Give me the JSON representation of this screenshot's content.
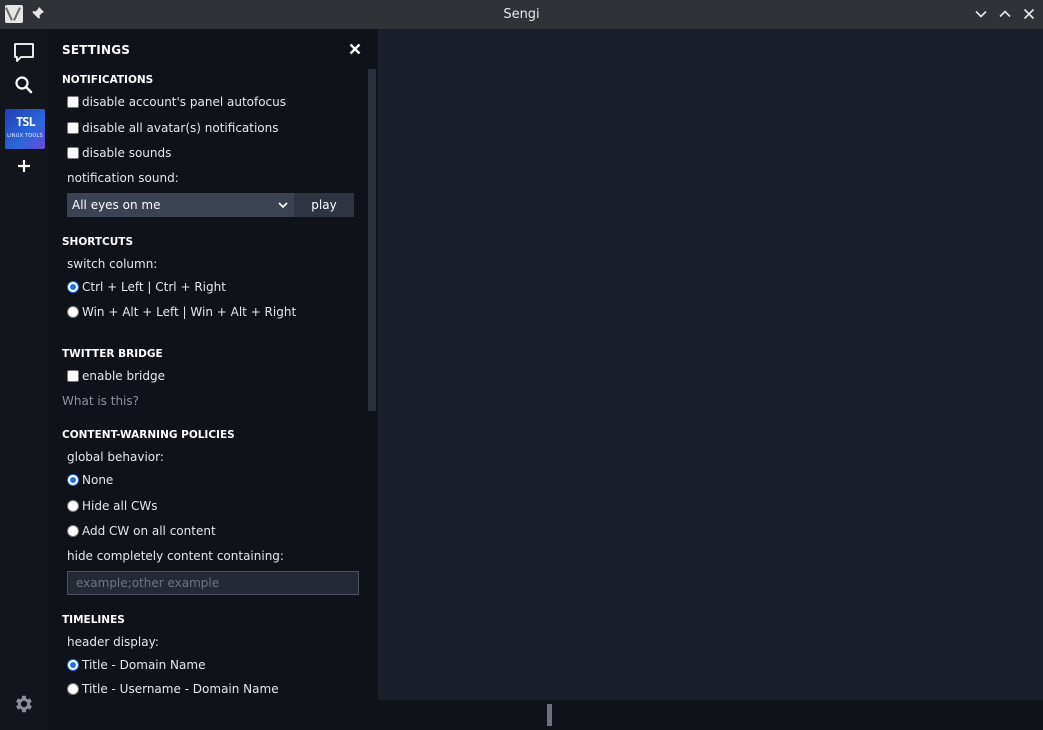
{
  "window": {
    "title": "Sengi"
  },
  "icons": {
    "app": "app-icon",
    "pin": "pin-icon",
    "minimize": "chevron-down-icon",
    "maximize": "chevron-up-icon",
    "close": "close-icon",
    "messages": "chat-bubble-icon",
    "search": "search-icon",
    "add": "plus-icon",
    "settings": "gear-icon",
    "select": "chevron-down-icon"
  },
  "account": {
    "avatar_line1": "TSL",
    "avatar_line2": "LINUX TOOLS"
  },
  "settings": {
    "title": "SETTINGS",
    "notifications": {
      "title": "NOTIFICATIONS",
      "disable_autofocus": "disable account's panel autofocus",
      "disable_avatar_notifications": "disable all avatar(s) notifications",
      "disable_sounds": "disable sounds",
      "sound_label": "notification sound:",
      "sound_value": "All eyes on me",
      "play_label": "play"
    },
    "shortcuts": {
      "title": "SHORTCUTS",
      "switch_label": "switch column:",
      "option1": "Ctrl + Left | Ctrl + Right",
      "option2": "Win + Alt + Left | Win + Alt + Right",
      "selected": "option1"
    },
    "twitter_bridge": {
      "title": "TWITTER BRIDGE",
      "enable_label": "enable bridge",
      "what_is_this": "What is this?"
    },
    "content_warning": {
      "title": "CONTENT-WARNING POLICIES",
      "global_label": "global behavior:",
      "none": "None",
      "hide_all": "Hide all CWs",
      "add_cw": "Add CW on all content",
      "selected": "none",
      "hide_containing_label": "hide completely content containing:",
      "hide_containing_placeholder": "example;other example"
    },
    "timelines": {
      "title": "TIMELINES",
      "header_display_label": "header display:",
      "option1": "Title - Domain Name",
      "option2": "Title - Username - Domain Name",
      "selected": "option1"
    }
  },
  "colors": {
    "titlebar": "#2f3237",
    "rail": "#12151c",
    "panel": "#0f1219",
    "main": "#1a1f2b",
    "accent": "#1f6fe8"
  }
}
